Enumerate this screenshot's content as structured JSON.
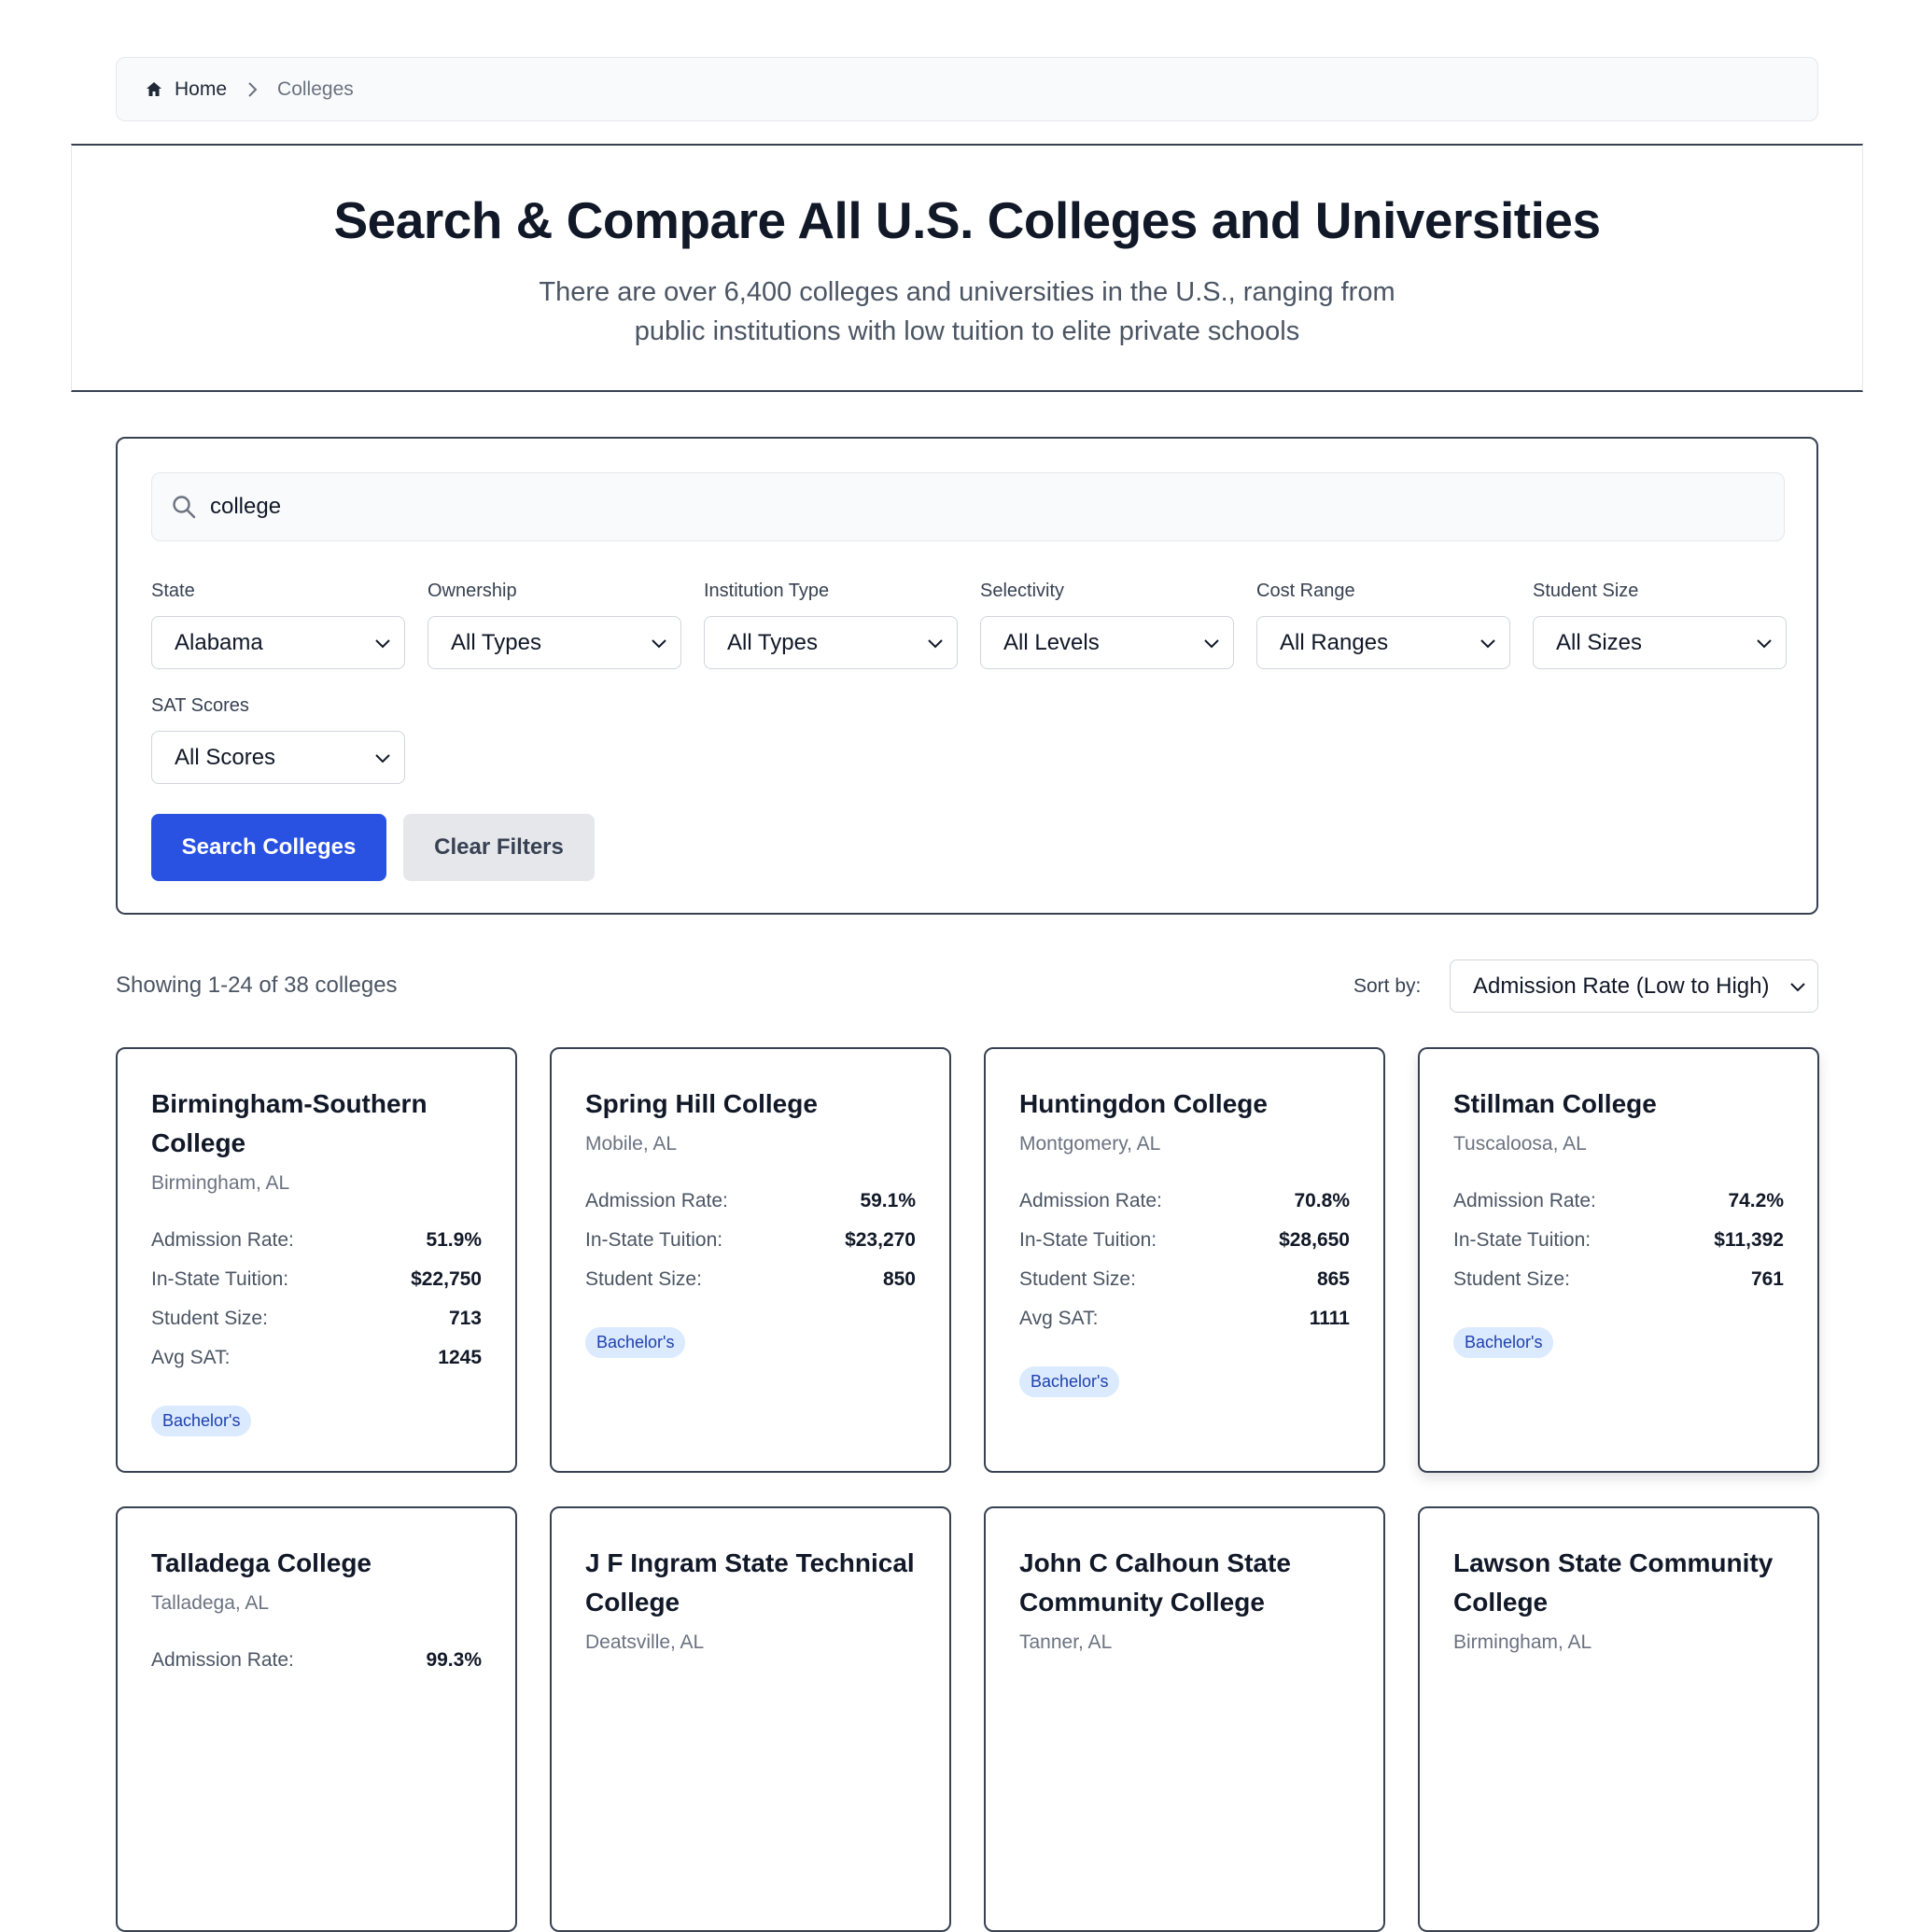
{
  "breadcrumb": {
    "home": "Home",
    "current": "Colleges"
  },
  "hero": {
    "title": "Search & Compare All U.S. Colleges and Universities",
    "subtitle": "There are over 6,400 colleges and universities in the U.S., ranging from public institutions with low tuition to elite private schools"
  },
  "search": {
    "value": "college"
  },
  "filters": [
    {
      "label": "State",
      "value": "Alabama"
    },
    {
      "label": "Ownership",
      "value": "All Types"
    },
    {
      "label": "Institution Type",
      "value": "All Types"
    },
    {
      "label": "Selectivity",
      "value": "All Levels"
    },
    {
      "label": "Cost Range",
      "value": "All Ranges"
    },
    {
      "label": "Student Size",
      "value": "All Sizes"
    },
    {
      "label": "SAT Scores",
      "value": "All Scores"
    }
  ],
  "buttons": {
    "search": "Search Colleges",
    "clear": "Clear Filters"
  },
  "results": {
    "count_text": "Showing 1-24 of 38 colleges",
    "sort_label": "Sort by:",
    "sort_value": "Admission Rate (Low to High)"
  },
  "labels": {
    "admission": "Admission Rate:",
    "tuition": "In-State Tuition:",
    "size": "Student Size:",
    "sat": "Avg SAT:"
  },
  "colleges": [
    {
      "name": "Birmingham-Southern College",
      "location": "Birmingham, AL",
      "admission": "51.9%",
      "tuition": "$22,750",
      "size": "713",
      "sat": "1245",
      "badge": "Bachelor's"
    },
    {
      "name": "Spring Hill College",
      "location": "Mobile, AL",
      "admission": "59.1%",
      "tuition": "$23,270",
      "size": "850",
      "badge": "Bachelor's"
    },
    {
      "name": "Huntingdon College",
      "location": "Montgomery, AL",
      "admission": "70.8%",
      "tuition": "$28,650",
      "size": "865",
      "sat": "1111",
      "badge": "Bachelor's"
    },
    {
      "name": "Stillman College",
      "location": "Tuscaloosa, AL",
      "admission": "74.2%",
      "tuition": "$11,392",
      "size": "761",
      "badge": "Bachelor's"
    },
    {
      "name": "Talladega College",
      "location": "Talladega, AL",
      "admission": "99.3%"
    },
    {
      "name": "J F Ingram State Technical College",
      "location": "Deatsville, AL"
    },
    {
      "name": "John C Calhoun State Community College",
      "location": "Tanner, AL"
    },
    {
      "name": "Lawson State Community College",
      "location": "Birmingham, AL"
    }
  ]
}
